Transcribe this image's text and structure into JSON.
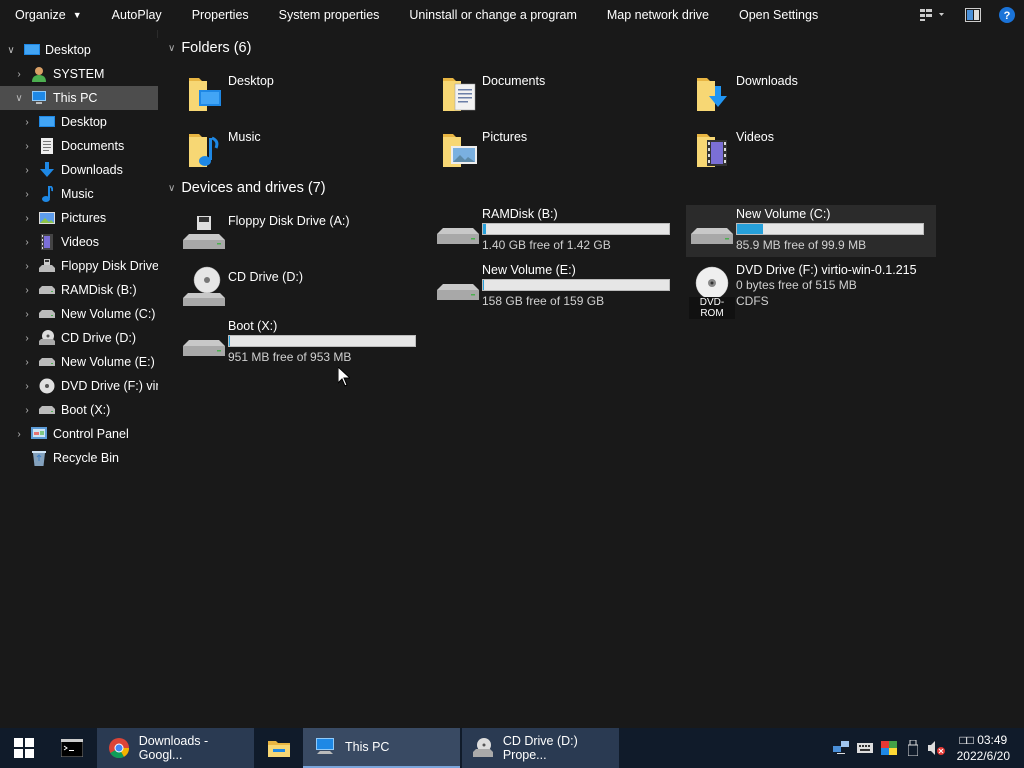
{
  "toolbar": {
    "organize": "Organize",
    "autoplay": "AutoPlay",
    "properties": "Properties",
    "system_properties": "System properties",
    "uninstall": "Uninstall or change a program",
    "map_network": "Map network drive",
    "open_settings": "Open Settings"
  },
  "nav": {
    "items": [
      {
        "label": "Desktop",
        "icon": "desktop-icon"
      },
      {
        "label": "SYSTEM",
        "icon": "user-icon"
      },
      {
        "label": "This PC",
        "icon": "computer-icon"
      },
      {
        "label": "Desktop",
        "icon": "desktop-icon"
      },
      {
        "label": "Documents",
        "icon": "documents-icon"
      },
      {
        "label": "Downloads",
        "icon": "download-icon"
      },
      {
        "label": "Music",
        "icon": "music-icon"
      },
      {
        "label": "Pictures",
        "icon": "pictures-icon"
      },
      {
        "label": "Videos",
        "icon": "videos-icon"
      },
      {
        "label": "Floppy Disk Drive",
        "icon": "floppy-icon"
      },
      {
        "label": "RAMDisk (B:)",
        "icon": "drive-icon"
      },
      {
        "label": "New Volume (C:)",
        "icon": "drive-icon"
      },
      {
        "label": "CD Drive (D:)",
        "icon": "cd-drive-icon"
      },
      {
        "label": "New Volume (E:)",
        "icon": "drive-icon"
      },
      {
        "label": "DVD Drive (F:) virti",
        "icon": "dvd-icon"
      },
      {
        "label": "Boot (X:)",
        "icon": "drive-icon"
      },
      {
        "label": "Control Panel",
        "icon": "control-panel-icon"
      },
      {
        "label": "Recycle Bin",
        "icon": "recycle-bin-icon"
      }
    ]
  },
  "folders": {
    "header": "Folders (6)",
    "items": [
      {
        "name": "Desktop",
        "icon": "folder-desktop-icon"
      },
      {
        "name": "Documents",
        "icon": "folder-documents-icon"
      },
      {
        "name": "Downloads",
        "icon": "folder-downloads-icon"
      },
      {
        "name": "Music",
        "icon": "folder-music-icon"
      },
      {
        "name": "Pictures",
        "icon": "folder-pictures-icon"
      },
      {
        "name": "Videos",
        "icon": "folder-videos-icon"
      }
    ]
  },
  "drives": {
    "header": "Devices and drives (7)",
    "items": [
      {
        "name": "Floppy Disk Drive (A:)",
        "icon": "floppy-drive-icon"
      },
      {
        "name": "RAMDisk (B:)",
        "free": "1.40 GB free of 1.42 GB",
        "used": 0.014
      },
      {
        "name": "New Volume (C:)",
        "free": "85.9 MB free of 99.9 MB",
        "used": 0.14
      },
      {
        "name": "CD Drive (D:)",
        "icon": "cd-drive-icon"
      },
      {
        "name": "New Volume (E:)",
        "free": "158 GB free of 159 GB",
        "used": 0.006
      },
      {
        "name": "DVD Drive (F:) virtio-win-0.1.215",
        "free": "0 bytes free of 515 MB",
        "fs": "CDFS",
        "label": "DVD-ROM"
      },
      {
        "name": "Boot (X:)",
        "free": "951 MB free of 953 MB",
        "used": 0.002
      }
    ]
  },
  "taskbar": {
    "chrome": "Downloads - Googl...",
    "thispc": "This PC",
    "cddrive": "CD Drive (D:) Prope...",
    "time": "□□ 03:49",
    "date": "2022/6/20"
  },
  "colors": {
    "accent": "#26a0da",
    "selection": "#4d4d4d",
    "background": "#191919",
    "taskbar": "#101b2a"
  }
}
